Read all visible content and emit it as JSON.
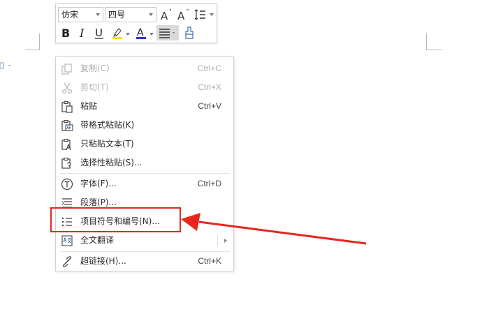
{
  "mini_toolbar": {
    "font_name": "仿宋",
    "font_size": "四号",
    "grow_font_glyph": "A",
    "shrink_font_glyph": "A",
    "bold_glyph": "B",
    "italic_glyph": "I",
    "underline_glyph": "U",
    "font_color_glyph": "A",
    "highlight_color": "#f5e400",
    "font_color": "#2a36d4"
  },
  "context_menu": {
    "items": [
      {
        "label": "复制(C)",
        "shortcut": "Ctrl+C",
        "icon": "copy-icon",
        "enabled": false
      },
      {
        "label": "剪切(T)",
        "shortcut": "Ctrl+X",
        "icon": "scissors-icon",
        "enabled": false
      },
      {
        "label": "粘贴",
        "shortcut": "Ctrl+V",
        "icon": "paste-icon",
        "enabled": true
      },
      {
        "label": "带格式粘贴(K)",
        "shortcut": "",
        "icon": "paste-formatted-icon",
        "enabled": true
      },
      {
        "label": "只粘贴文本(T)",
        "shortcut": "",
        "icon": "paste-text-icon",
        "enabled": true
      },
      {
        "label": "选择性粘贴(S)...",
        "shortcut": "",
        "icon": "paste-special-icon",
        "enabled": true
      },
      {
        "label": "字体(F)...",
        "shortcut": "Ctrl+D",
        "icon": "font-icon",
        "enabled": true
      },
      {
        "label": "段落(P)...",
        "shortcut": "",
        "icon": "paragraph-icon",
        "enabled": true
      },
      {
        "label": "项目符号和编号(N)...",
        "shortcut": "",
        "icon": "bullets-list-icon",
        "enabled": true
      },
      {
        "label": "全文翻译",
        "shortcut": "",
        "icon": "translate-icon",
        "enabled": true
      },
      {
        "label": "超链接(H)...",
        "shortcut": "Ctrl+K",
        "icon": "link-icon",
        "enabled": true
      }
    ]
  },
  "annotation": {
    "highlight_color": "#e8261e"
  }
}
